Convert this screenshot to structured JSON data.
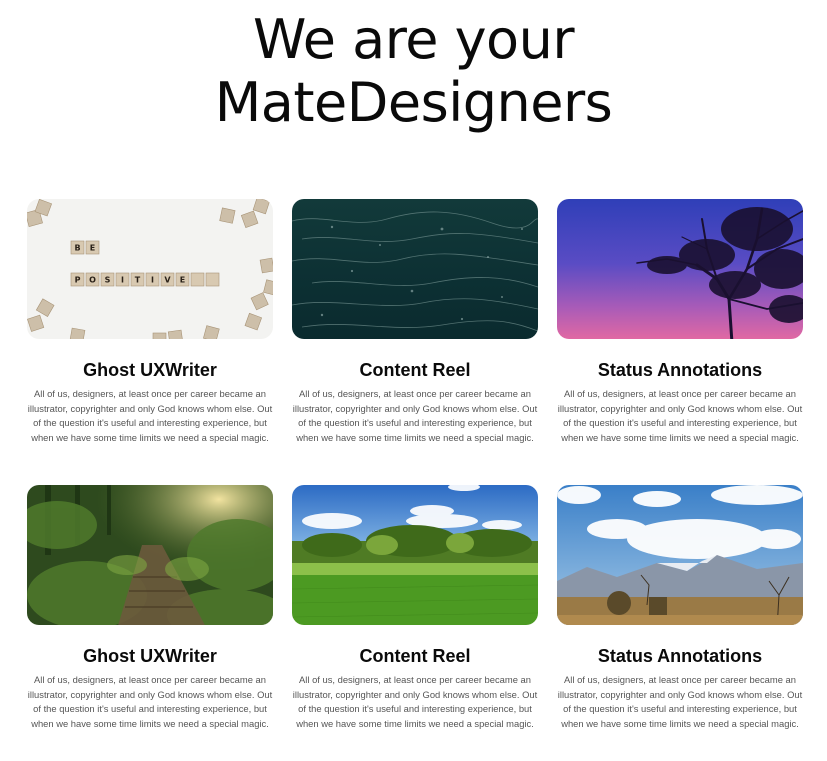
{
  "hero": {
    "line1": "We are your",
    "line2": "MateDesigners"
  },
  "cards": [
    {
      "title": "Ghost UXWriter",
      "description": "All of us, designers, at least once per career became an illustrator, copyrighter and only God knows whom else. Out of the question it's useful and interesting experience, but when we have some time limits we need a special magic.",
      "image": "scrabble-be-positive-photo",
      "tiles": [
        "B",
        "E",
        "P",
        "O",
        "S",
        "I",
        "T",
        "I",
        "V",
        "E"
      ]
    },
    {
      "title": "Content Reel",
      "description": "All of us, designers, at least once per career became an illustrator, copyrighter and only God knows whom else. Out of the question it's useful and interesting experience, but when we have some time limits we need a special magic.",
      "image": "dark-ocean-waves-photo"
    },
    {
      "title": "Status Annotations",
      "description": "All of us, designers, at least once per career became an illustrator, copyrighter and only God knows whom else. Out of the question it's useful and interesting experience, but when we have some time limits we need a special magic.",
      "image": "tree-silhouette-sunset-photo"
    },
    {
      "title": "Ghost UXWriter",
      "description": "All of us, designers, at least once per career became an illustrator, copyrighter and only God knows whom else. Out of the question it's useful and interesting experience, but when we have some time limits we need a special magic.",
      "image": "forest-path-photo"
    },
    {
      "title": "Content Reel",
      "description": "All of us, designers, at least once per career became an illustrator, copyrighter and only God knows whom else. Out of the question it's useful and interesting experience, but when we have some time limits we need a special magic.",
      "image": "green-field-blue-sky-photo"
    },
    {
      "title": "Status Annotations",
      "description": "All of us, designers, at least once per career became an illustrator, copyrighter and only God knows whom else. Out of the question it's useful and interesting experience, but when we have some time limits we need a special magic.",
      "image": "mountain-landscape-clouds-photo"
    }
  ],
  "colors": {
    "heading": "#0a0a0a",
    "body_text": "#555555",
    "background": "#ffffff"
  }
}
